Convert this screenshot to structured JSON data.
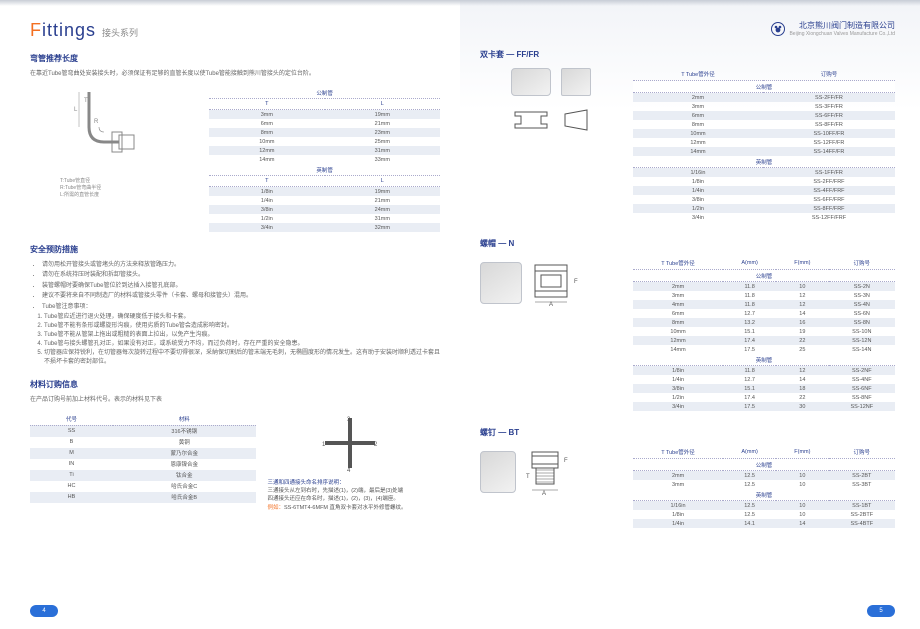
{
  "header": {
    "title_en_prefix": "F",
    "title_en_rest": "ittings",
    "title_cn": "接头系列",
    "company_cn": "北京熊川阀门制造有限公司",
    "company_en": "Beijing Xiongchuan Valves Manufacture Co.,Ltd"
  },
  "left": {
    "sec1": {
      "title": "弯管推荐长度",
      "desc": "在靠近Tube管弯曲处安装接头时，必须保证有足够的直管长度以使Tube管能接触到熊川管接头的定位台阶。",
      "diagram_labels": {
        "t": "T:Tube管直径",
        "r": "R:Tube管弯曲半径",
        "l": "L:所需的直管长度"
      },
      "table": {
        "cols": [
          "T",
          "L"
        ],
        "sub1": "公制管",
        "rows1": [
          [
            "3mm",
            "19mm"
          ],
          [
            "6mm",
            "21mm"
          ],
          [
            "8mm",
            "23mm"
          ],
          [
            "10mm",
            "25mm"
          ],
          [
            "12mm",
            "31mm"
          ],
          [
            "14mm",
            "33mm"
          ]
        ],
        "sub2": "英制管",
        "rows2": [
          [
            "1/8in",
            "19mm"
          ],
          [
            "1/4in",
            "21mm"
          ],
          [
            "3/8in",
            "24mm"
          ],
          [
            "1/2in",
            "31mm"
          ],
          [
            "3/4in",
            "32mm"
          ]
        ]
      }
    },
    "sec2": {
      "title": "安全预防措施",
      "bullets": [
        "请勿用松开管接头或管堵头的方法来释放管路压力。",
        "请勿在系统持压时装配和拆卸管接头。",
        "装管螺帽时要确保Tube管位於到达插入接管孔底部。",
        "建议不要将来自不同制造厂的材料或管接头零件（卡套、螺母和接管头）混用。",
        "Tube管注意事项："
      ],
      "numbered": [
        "Tube管应近进行退火处理，确保硬度低于接头和卡套。",
        "Tube管不能有条形或螺旋形沟痕，使用劣质的Tube管会造成影响密封。",
        "Tube管不能从管架上拖出或粗糙的表面上拉出，以免产生沟痕。",
        "Tube管与接头螺管孔对正，如果没有对正，或系统受力不均，而过负荷时，存在严重的安全隐患。",
        "切管器应保持锐利，在切管器每次旋转过程中不要切得很深，采納保切割后的管末端无毛刺，无椭圆度形的情况发生。这有助于安装时顺利透过卡套且不损坏卡套的密封部位。"
      ]
    },
    "sec3": {
      "title": "材料订购信息",
      "desc": "在产品订购号前加上材料代号。表示的材料见下表",
      "table": {
        "cols": [
          "代号",
          "材料"
        ],
        "rows": [
          [
            "SS",
            "316不锈钢"
          ],
          [
            "B",
            "黄铜"
          ],
          [
            "M",
            "蒙乃尔合金"
          ],
          [
            "IN",
            "恩康镍合金"
          ],
          [
            "Ti",
            "钛合金"
          ],
          [
            "HC",
            "哈氏合金C"
          ],
          [
            "HB",
            "哈氏合金B"
          ]
        ]
      },
      "cross": {
        "ln1": "三通和四通接头命名排序说明：",
        "ln2": "三通接头从左到右时，先描述(1)，(2)端，最后是(3)处端",
        "ln3": "四通接头还应在命名时，描述(1)，(2)，(3)，(4)端座。",
        "ln4a": "例如：",
        "ln4b": "SS-6TMT4-6MFM 直角双卡套对水平外修管螺纹。"
      }
    },
    "page_num": "4"
  },
  "right": {
    "sec1": {
      "title": "双卡套 — FF/FR",
      "table": {
        "cols": [
          "T Tube管外径",
          "订购号"
        ],
        "sub1": "公制管",
        "rows1": [
          [
            "2mm",
            "SS-2FF/FR"
          ],
          [
            "3mm",
            "SS-3FF/FR"
          ],
          [
            "6mm",
            "SS-6FF/FR"
          ],
          [
            "8mm",
            "SS-8FF/FR"
          ],
          [
            "10mm",
            "SS-10FF/FR"
          ],
          [
            "12mm",
            "SS-12FF/FR"
          ],
          [
            "14mm",
            "SS-14FF/FR"
          ]
        ],
        "sub2": "英制管",
        "rows2": [
          [
            "1/16in",
            "SS-1FF/FR"
          ],
          [
            "1/8in",
            "SS-2FF/FRF"
          ],
          [
            "1/4in",
            "SS-4FF/FRF"
          ],
          [
            "3/8in",
            "SS-6FF/FRF"
          ],
          [
            "1/2in",
            "SS-8FF/FRF"
          ],
          [
            "3/4in",
            "SS-12FF/FRF"
          ]
        ]
      }
    },
    "sec2": {
      "title": "螺帽 — N",
      "table": {
        "cols": [
          "T Tube管外径",
          "A(mm)",
          "F(mm)",
          "订购号"
        ],
        "sub1": "公制管",
        "rows1": [
          [
            "2mm",
            "11.8",
            "10",
            "SS-2N"
          ],
          [
            "3mm",
            "11.8",
            "12",
            "SS-3N"
          ],
          [
            "4mm",
            "11.8",
            "12",
            "SS-4N"
          ],
          [
            "6mm",
            "12.7",
            "14",
            "SS-6N"
          ],
          [
            "8mm",
            "13.2",
            "16",
            "SS-8N"
          ],
          [
            "10mm",
            "15.1",
            "19",
            "SS-10N"
          ],
          [
            "12mm",
            "17.4",
            "22",
            "SS-12N"
          ],
          [
            "14mm",
            "17.5",
            "25",
            "SS-14N"
          ]
        ],
        "sub2": "英制管",
        "rows2": [
          [
            "1/8in",
            "11.8",
            "12",
            "SS-2NF"
          ],
          [
            "1/4in",
            "12.7",
            "14",
            "SS-4NF"
          ],
          [
            "3/8in",
            "15.1",
            "18",
            "SS-6NF"
          ],
          [
            "1/2in",
            "17.4",
            "22",
            "SS-8NF"
          ],
          [
            "3/4in",
            "17.5",
            "30",
            "SS-12NF"
          ]
        ]
      }
    },
    "sec3": {
      "title": "螺钉 — BT",
      "table": {
        "cols": [
          "T Tube管外径",
          "A(mm)",
          "F(mm)",
          "订购号"
        ],
        "sub1": "公制管",
        "rows1": [
          [
            "2mm",
            "12.5",
            "10",
            "SS-2BT"
          ],
          [
            "3mm",
            "12.5",
            "10",
            "SS-3BT"
          ]
        ],
        "sub2": "英制管",
        "rows2": [
          [
            "1/16in",
            "12.5",
            "10",
            "SS-1BT"
          ],
          [
            "1/8in",
            "12.5",
            "10",
            "SS-2BTF"
          ],
          [
            "1/4in",
            "14.1",
            "14",
            "SS-4BTF"
          ]
        ]
      }
    },
    "page_num": "5"
  }
}
